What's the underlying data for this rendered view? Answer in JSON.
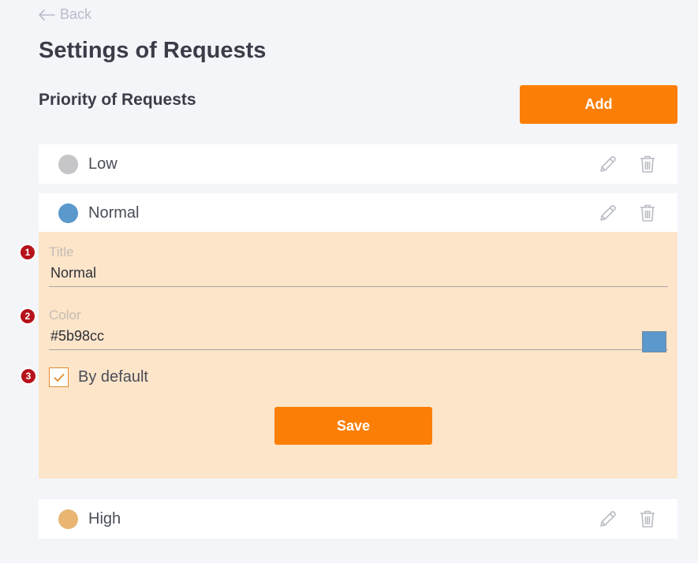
{
  "nav": {
    "back_label": "Back"
  },
  "page": {
    "title": "Settings of Requests"
  },
  "section": {
    "title": "Priority of Requests",
    "add_label": "Add"
  },
  "priorities": [
    {
      "label": "Low",
      "color": "#c6c6c8"
    },
    {
      "label": "Normal",
      "color": "#5b98cc"
    },
    {
      "label": "High",
      "color": "#e8b672"
    }
  ],
  "editor": {
    "title_label": "Title",
    "title_value": "Normal",
    "color_label": "Color",
    "color_value": "#5b98cc",
    "default_label": "By default",
    "default_checked": true,
    "save_label": "Save"
  },
  "markers": [
    "1",
    "2",
    "3"
  ],
  "colors": {
    "accent": "#fb7f06",
    "panel_bg": "#fde5ca",
    "badge": "#b5121b"
  }
}
